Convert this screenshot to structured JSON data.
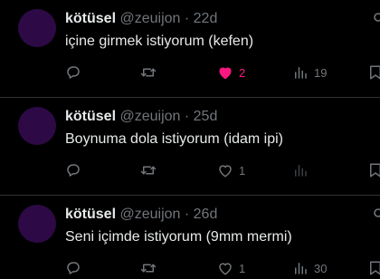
{
  "tweets": [
    {
      "display_name": "kötüsel",
      "handle": "@zeuijon",
      "separator": "·",
      "time": "22d",
      "text": "içine girmek istiyorum (kefen)",
      "replies": "",
      "retweets": "",
      "likes": "2",
      "liked": true,
      "views": "19"
    },
    {
      "display_name": "kötüsel",
      "handle": "@zeuijon",
      "separator": "·",
      "time": "25d",
      "text": "Boynuma dola istiyorum (idam ipi)",
      "replies": "",
      "retweets": "",
      "likes": "1",
      "liked": false,
      "views": ""
    },
    {
      "display_name": "kötüsel",
      "handle": "@zeuijon",
      "separator": "·",
      "time": "26d",
      "text": "Seni içimde istiyorum (9mm mermi)",
      "replies": "",
      "retweets": "",
      "likes": "1",
      "liked": false,
      "views": "30"
    }
  ],
  "colors": {
    "background": "#000000",
    "text": "#e7e9ea",
    "muted": "#71767b",
    "like_active": "#f91880",
    "avatar": "#2d0a46",
    "divider": "#2f3336"
  },
  "icons": [
    "reply-icon",
    "retweet-icon",
    "heart-icon",
    "views-icon",
    "bookmark-icon",
    "more-icon"
  ]
}
